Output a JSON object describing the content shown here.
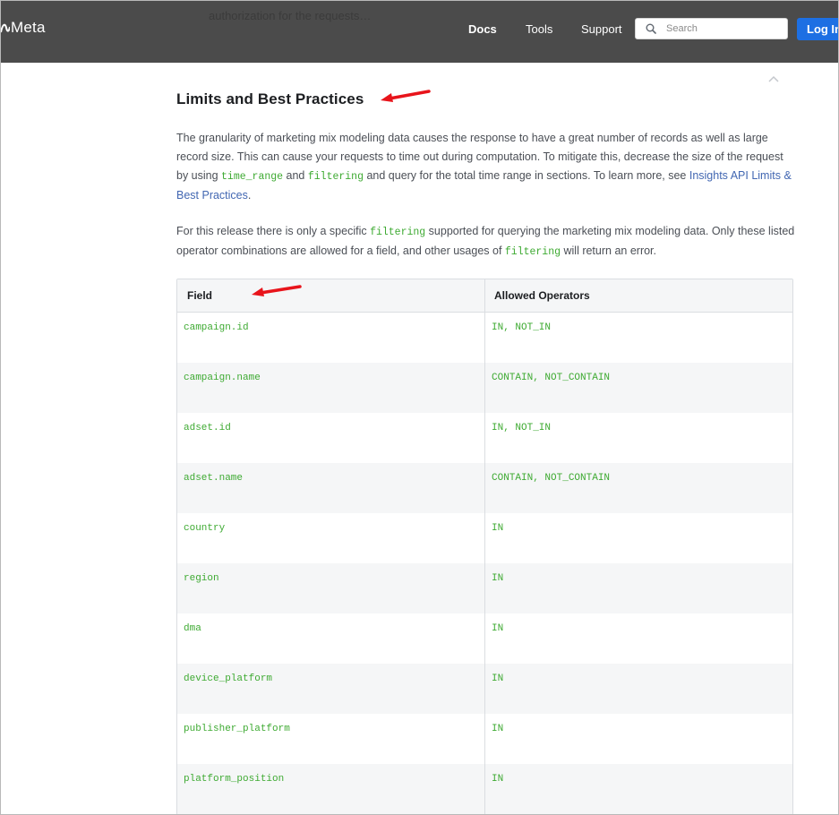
{
  "header": {
    "ghost_text": "authorization for the requests…",
    "logo_text": "Meta",
    "nav": {
      "docs": "Docs",
      "tools": "Tools",
      "support": "Support"
    },
    "search": {
      "placeholder": "Search"
    },
    "login_label": "Log In"
  },
  "section": {
    "title": "Limits and Best Practices",
    "p1": {
      "t1": "The granularity of marketing mix modeling data causes the response to have a great number of records as well as large record size. This can cause your requests to time out during computation. To mitigate this, decrease the size of the request by using ",
      "c1": "time_range",
      "t2": " and ",
      "c2": "filtering",
      "t3": " and query for the total time range in sections. To learn more, see ",
      "link": "Insights API Limits & Best Practices",
      "t4": "."
    },
    "p2": {
      "t1": "For this release there is only a specific ",
      "c1": "filtering",
      "t2": " supported for querying the marketing mix modeling data. Only these listed operator combinations are allowed for a field, and other usages of ",
      "c2": "filtering",
      "t3": " will return an error."
    }
  },
  "table": {
    "headers": [
      "Field",
      "Allowed Operators"
    ],
    "rows": [
      {
        "field": "campaign.id",
        "ops": "IN, NOT_IN"
      },
      {
        "field": "campaign.name",
        "ops": "CONTAIN, NOT_CONTAIN"
      },
      {
        "field": "adset.id",
        "ops": "IN, NOT_IN"
      },
      {
        "field": "adset.name",
        "ops": "CONTAIN, NOT_CONTAIN"
      },
      {
        "field": "country",
        "ops": "IN"
      },
      {
        "field": "region",
        "ops": "IN"
      },
      {
        "field": "dma",
        "ops": "IN"
      },
      {
        "field": "device_platform",
        "ops": "IN"
      },
      {
        "field": "publisher_platform",
        "ops": "IN"
      },
      {
        "field": "platform_position",
        "ops": "IN"
      }
    ]
  },
  "colors": {
    "header_bg": "#4b4b4b",
    "code_green": "#3eaa32",
    "link_blue": "#4267b2",
    "login_blue": "#1d6fe3",
    "annotation_red": "#e8141b"
  },
  "icons": {
    "logo": "meta-infinity-icon",
    "search": "search-icon",
    "collapse": "chevron-up-icon",
    "annotation": "red-arrow-icon"
  }
}
